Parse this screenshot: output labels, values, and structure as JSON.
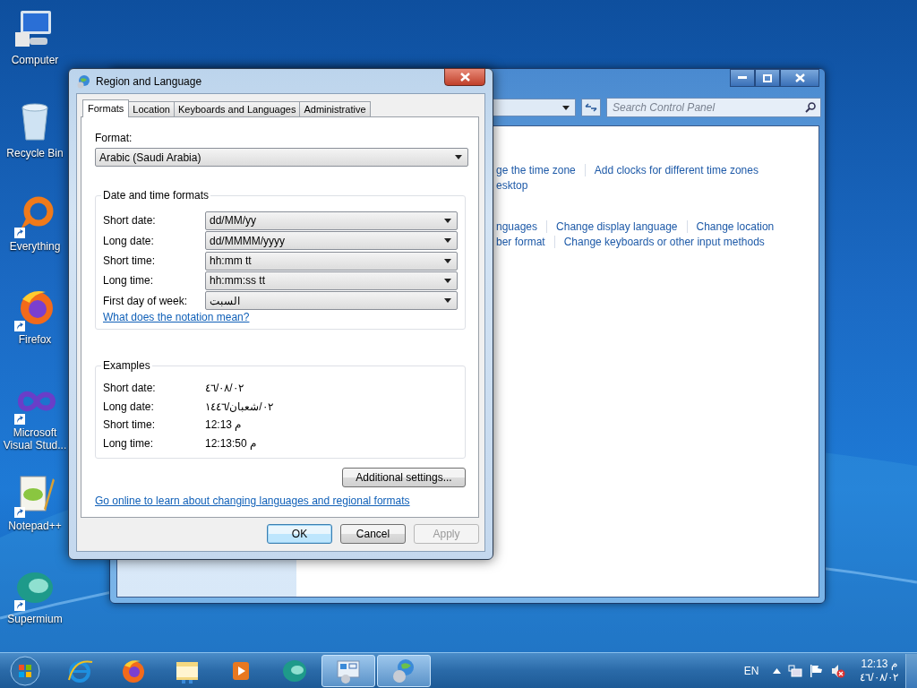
{
  "desktop_icons": [
    {
      "kind": "computer",
      "label": "Computer",
      "shortcut": false
    },
    {
      "kind": "recycle-bin",
      "label": "Recycle Bin",
      "shortcut": false
    },
    {
      "kind": "ring",
      "label": "Everything",
      "shortcut": true
    },
    {
      "kind": "firefox",
      "label": "Firefox",
      "shortcut": true
    },
    {
      "kind": "infinity",
      "label": "Microsoft Visual Stud...",
      "shortcut": true
    },
    {
      "kind": "notepad",
      "label": "Notepad++",
      "shortcut": true
    },
    {
      "kind": "globe-leaf",
      "label": "Supermium",
      "shortcut": true
    }
  ],
  "control_panel": {
    "search": {
      "placeholder": "Search Control Panel"
    },
    "link_rows": [
      [
        "ge the time zone",
        "Add clocks for different time zones"
      ],
      [
        "esktop"
      ],
      [
        "nguages",
        "Change display language",
        "Change location"
      ],
      [
        "ber format",
        "Change keyboards or other input methods"
      ]
    ]
  },
  "dialog": {
    "title": "Region and Language",
    "tabs": [
      {
        "label": "Formats",
        "selected": true
      },
      {
        "label": "Location",
        "selected": false
      },
      {
        "label": "Keyboards and Languages",
        "selected": false
      },
      {
        "label": "Administrative",
        "selected": false
      }
    ],
    "format": {
      "label": "Format:",
      "value": "Arabic (Saudi Arabia)"
    },
    "date_time_formats": {
      "title": "Date and time formats",
      "rows": [
        {
          "label": "Short date:",
          "value": "dd/MM/yy"
        },
        {
          "label": "Long date:",
          "value": "dd/MMMM/yyyy"
        },
        {
          "label": "Short time:",
          "value": "hh:mm tt"
        },
        {
          "label": "Long time:",
          "value": "hh:mm:ss tt"
        },
        {
          "label": "First day of week:",
          "value": "السبت"
        }
      ],
      "link": "What does the notation mean?"
    },
    "examples": {
      "title": "Examples",
      "rows": [
        {
          "label": "Short date:",
          "value": "٤٦/٠٨/٠٢"
        },
        {
          "label": "Long date:",
          "value": "٠٢/شعبان/١٤٤٦"
        },
        {
          "label": "Short time:",
          "value": "12:13 م"
        },
        {
          "label": "Long time:",
          "value": "12:13:50 م"
        }
      ]
    },
    "additional_button": "Additional settings...",
    "online_link": "Go online to learn about changing languages and regional formats",
    "buttons": [
      {
        "label": "OK",
        "default": true,
        "disabled": false
      },
      {
        "label": "Cancel",
        "default": false,
        "disabled": false
      },
      {
        "label": "Apply",
        "default": false,
        "disabled": true
      }
    ]
  },
  "taskbar": {
    "apps": [
      {
        "kind": "ie",
        "active": false
      },
      {
        "kind": "firefox",
        "active": false
      },
      {
        "kind": "folder",
        "active": false
      },
      {
        "kind": "player",
        "active": false
      },
      {
        "kind": "globe-leaf",
        "active": false
      },
      {
        "kind": "control-panel",
        "active": true
      },
      {
        "kind": "region",
        "active": true
      }
    ],
    "language": "EN",
    "time": "12:13 م",
    "date": "٤٦/٠٨/٠٢"
  }
}
